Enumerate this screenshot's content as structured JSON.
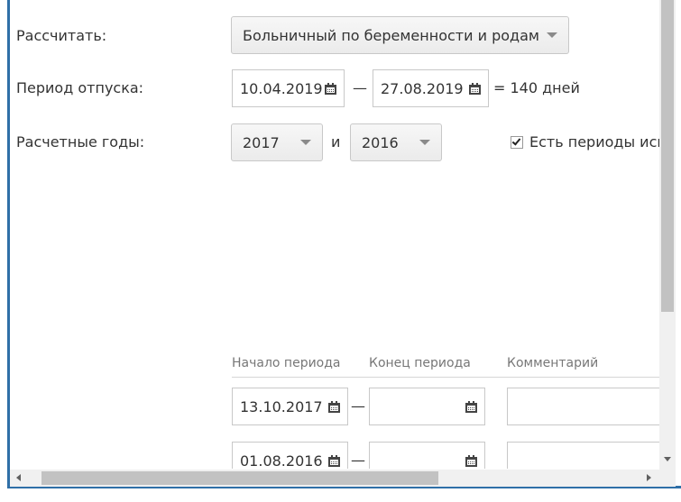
{
  "form": {
    "calculate_label": "Рассчитать:",
    "calculate_value": "Больничный по беременности и родам",
    "period_label": "Период отпуска:",
    "period_start": "10.04.2019",
    "period_end": "27.08.2019",
    "period_sep": "—",
    "period_result": "= 140 дней",
    "years_label": "Расчетные годы:",
    "year1": "2017",
    "years_conj": "и",
    "year2": "2016",
    "exclusion_checkbox_label": "Есть периоды иск",
    "exclusion_checked": true
  },
  "exclusions": {
    "columns": [
      "Начало периода",
      "Конец периода",
      "Комментарий"
    ],
    "rows": [
      {
        "start": "13.10.2017",
        "sep": "—",
        "end": "",
        "comment": ""
      },
      {
        "start": "01.08.2016",
        "sep": "—",
        "end": "",
        "comment": ""
      }
    ]
  },
  "icons": {
    "date_picker": "calendar-icon",
    "dropdown": "chevron-down-icon",
    "scroll_left": "arrow-left-icon",
    "scroll_right": "arrow-right-icon",
    "scroll_down": "arrow-down-icon"
  },
  "colors": {
    "window_border": "#2f6fa7",
    "text": "#333333",
    "muted_text": "#777777"
  }
}
